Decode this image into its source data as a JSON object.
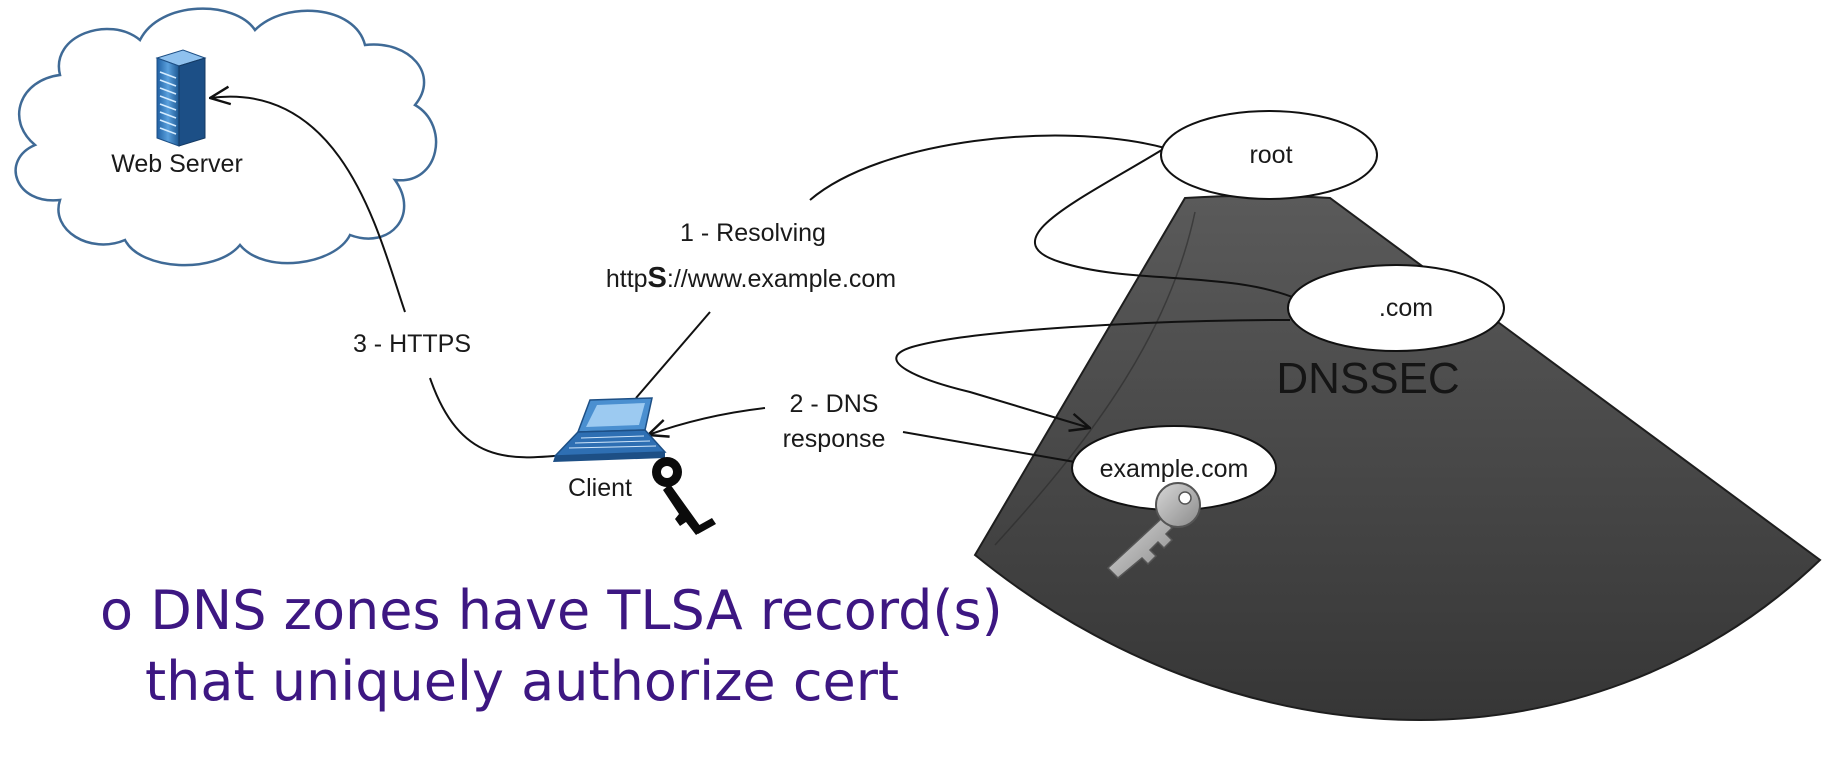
{
  "nodes": {
    "web_server": "Web Server",
    "client": "Client",
    "root": "root",
    "com": ".com",
    "example_com": "example.com",
    "dnssec": "DNSSEC"
  },
  "edges": {
    "step1_line1": "1 - Resolving",
    "step1_url_prefix": "http",
    "step1_url_emphasis": "S",
    "step1_url_rest": "://www.example.com",
    "step2_line1": "2 - DNS",
    "step2_line2": "response",
    "step3": "3 - HTTPS"
  },
  "bullet": {
    "marker": "o",
    "line1": "DNS zones have TLSA record(s)",
    "line2": "that uniquely authorize cert"
  },
  "colors": {
    "cloud_stroke": "#3f6a96",
    "server_blue": "#3b7fc4",
    "dnssec_fill": "#464646",
    "bullet_text": "#3d1782"
  }
}
